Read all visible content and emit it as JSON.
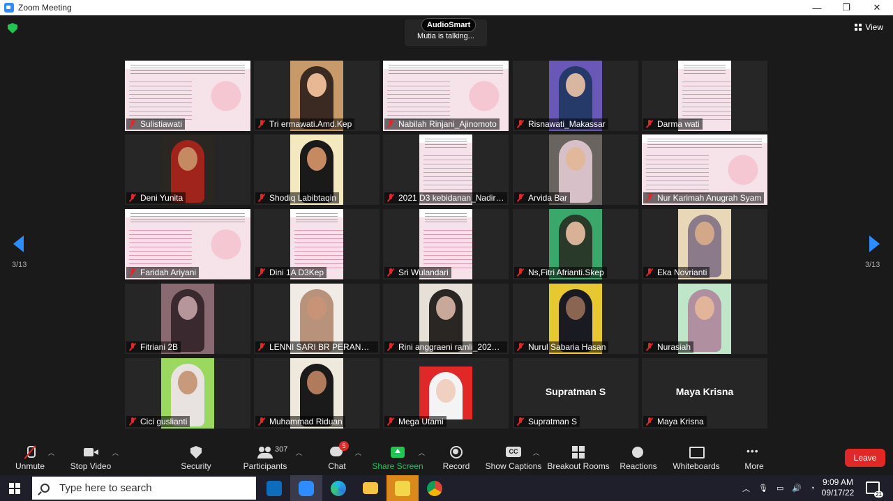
{
  "window": {
    "title": "Zoom Meeting",
    "minimize": "—",
    "restore": "❐",
    "close": "✕"
  },
  "topbar": {
    "audiosmart": "AudioSmart",
    "talking": "Mutia is talking...",
    "view_label": "View"
  },
  "pager": {
    "left": "3/13",
    "right": "3/13"
  },
  "participants": [
    {
      "name": "Sulistiawati",
      "kind": "slide"
    },
    {
      "name": "Tri ermawati.Amd.Kep",
      "kind": "video",
      "bg": "#c89a6a",
      "skin": "#e8b894",
      "hair": "#3a2a22"
    },
    {
      "name": "Nabilah Rinjani_Ajinomoto",
      "kind": "slide"
    },
    {
      "name": "Risnawati_Makassar",
      "kind": "video",
      "bg": "#6a58b8",
      "skin": "#d8b6a0",
      "hair": "#263a6a"
    },
    {
      "name": "Darma wati",
      "kind": "slide"
    },
    {
      "name": "Deni Yunita",
      "kind": "video",
      "bg": "#2a2622",
      "skin": "#c58a62",
      "hair": "#a0241c"
    },
    {
      "name": "Shodiq Labibtaqin",
      "kind": "video",
      "bg": "#f4e8c0",
      "skin": "#c58a62",
      "hair": "#1a1a1a"
    },
    {
      "name": "2021 D3 kebidanan_Nadira...",
      "kind": "slide"
    },
    {
      "name": "Arvida Bar",
      "kind": "video",
      "bg": "#6a6460",
      "skin": "#e2b89c",
      "hair": "#d8c0c8"
    },
    {
      "name": "Nur Karimah Anugrah Syam",
      "kind": "slide"
    },
    {
      "name": "Faridah Ariyani",
      "kind": "slide"
    },
    {
      "name": "Dini 1A D3Kep",
      "kind": "slide"
    },
    {
      "name": "Sri Wulandari",
      "kind": "slide"
    },
    {
      "name": "Ns,Fitri Afrianti.Skep",
      "kind": "video",
      "bg": "#3aa86a",
      "skin": "#d8b296",
      "hair": "#2a3a2a"
    },
    {
      "name": "Eka Novrianti",
      "kind": "video",
      "bg": "#e8d8b8",
      "skin": "#d2a888",
      "hair": "#8a7a8a"
    },
    {
      "name": "Fitriani 2B",
      "kind": "video",
      "bg": "#8a6a72",
      "skin": "#b6969a",
      "hair": "#3a2a30"
    },
    {
      "name": "LENNI SARI BR PERANGIN ...",
      "kind": "video",
      "bg": "#f0ebe4",
      "skin": "#c89478",
      "hair": "#b8927a"
    },
    {
      "name": "Rini anggraeni ramli_20210...",
      "kind": "video",
      "bg": "#e6e0d8",
      "skin": "#c8a898",
      "hair": "#2a2624"
    },
    {
      "name": "Nurul Sabaria Hasan",
      "kind": "video",
      "bg": "#e8c832",
      "skin": "#8a6652",
      "hair": "#1a1a22"
    },
    {
      "name": "Nurasiah",
      "kind": "video",
      "bg": "#bfe6c8",
      "skin": "#e2b49a",
      "hair": "#b090a0"
    },
    {
      "name": "Cici guslianti",
      "kind": "video",
      "bg": "#9ad860",
      "skin": "#c89a7c",
      "hair": "#e8e2e0"
    },
    {
      "name": "Muhammad Riduan",
      "kind": "video",
      "bg": "#efe8dc",
      "skin": "#b07a5c",
      "hair": "#1a1a1a"
    },
    {
      "name": "Mega Utami",
      "kind": "photo",
      "bg": "#e02828",
      "skin": "#f0d0c0",
      "hair": "#f4f4f4"
    },
    {
      "name": "Supratman S",
      "kind": "nameonly"
    },
    {
      "name": "Maya Krisna",
      "kind": "nameonly"
    }
  ],
  "toolbar": {
    "unmute": "Unmute",
    "stop_video": "Stop Video",
    "security": "Security",
    "participants": "Participants",
    "participants_count": "307",
    "chat": "Chat",
    "chat_badge": "5",
    "share_screen": "Share Screen",
    "record": "Record",
    "show_captions": "Show Captions",
    "breakout_rooms": "Breakout Rooms",
    "reactions": "Reactions",
    "whiteboards": "Whiteboards",
    "more": "More",
    "leave": "Leave",
    "share_color": "#23c552",
    "leave_color": "#e02828"
  },
  "taskbar": {
    "search_placeholder": "Type here to search",
    "time": "9:09 AM",
    "date": "09/17/22",
    "notifications": "21",
    "apps": [
      "outlook-icon",
      "zoom-icon",
      "edge-icon",
      "file-explorer-icon",
      "sticky-notes-icon",
      "chrome-icon"
    ]
  }
}
